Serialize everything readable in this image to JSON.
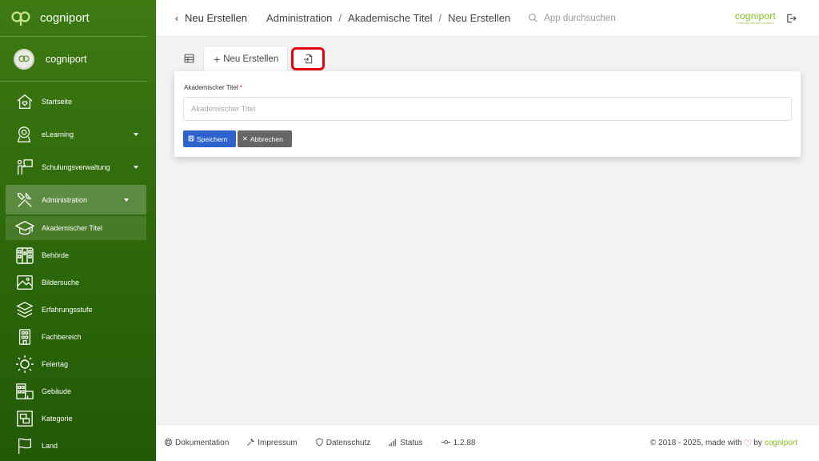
{
  "sidebar": {
    "brand": "cogniport",
    "user": "cogniport",
    "items": [
      {
        "label": "Startseite"
      },
      {
        "label": "eLearning"
      },
      {
        "label": "Schulungsverwaltung"
      },
      {
        "label": "Administration"
      },
      {
        "label": "Akademischer Titel"
      },
      {
        "label": "Behörde"
      },
      {
        "label": "Bildersuche"
      },
      {
        "label": "Erfahrungsstufe"
      },
      {
        "label": "Fachbereich"
      },
      {
        "label": "Feiertag"
      },
      {
        "label": "Gebäude"
      },
      {
        "label": "Kategorie"
      },
      {
        "label": "Land"
      }
    ]
  },
  "topbar": {
    "back_label": "Neu Erstellen",
    "crumbs": [
      "Administration",
      "Akademische Titel",
      "Neu Erstellen"
    ],
    "search_placeholder": "App durchsuchen",
    "brand": "cogniport",
    "brand_tagline": "Potential effizient entfalten"
  },
  "tabs": {
    "new_label": "Neu Erstellen"
  },
  "form": {
    "field_label": "Akademischer Titel",
    "required_mark": "*",
    "field_placeholder": "Akademischer Titel",
    "save_label": "Speichern",
    "cancel_label": "Abbrechen"
  },
  "footer": {
    "links": [
      "Dokumentation",
      "Impressum",
      "Datenschutz",
      "Status"
    ],
    "version": "1.2.88",
    "copyright": "© 2018 - 2025, made with",
    "by": "by",
    "brand": "cogniport"
  },
  "colors": {
    "sidebar": "#2f6a0c",
    "accent": "#7fbf1e",
    "primary": "#2e62cc",
    "highlight": "#e8000b"
  }
}
